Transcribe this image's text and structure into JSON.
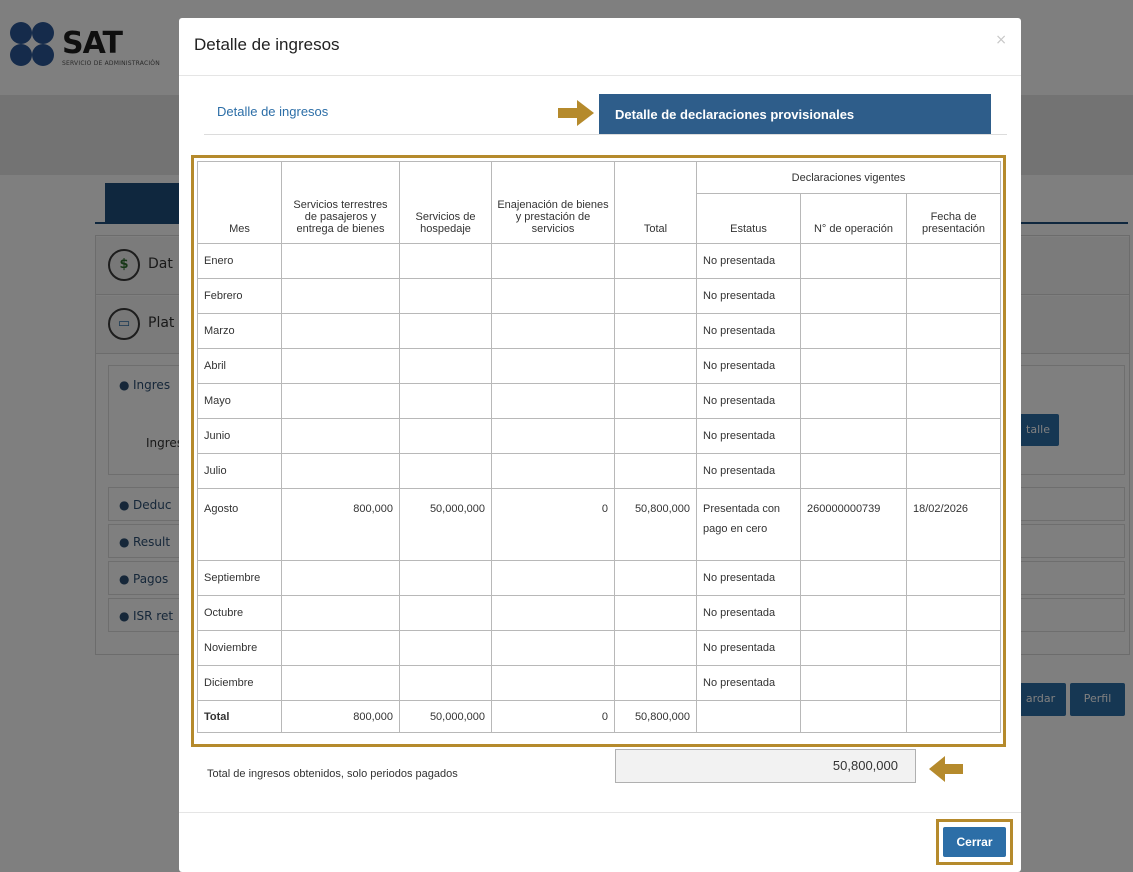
{
  "colors": {
    "accent": "#2c6ea7",
    "tab_active": "#2e5d8a",
    "highlight": "#b58a2c",
    "brand": "#2b5797"
  },
  "background": {
    "logo_text": "SAT",
    "logo_subtitle": "SERVICIO DE ADMINISTRACIÓN",
    "sections": [
      "Dat",
      "Plat"
    ],
    "sub_items": [
      "Ingres",
      "Deduc",
      "Result",
      "Pagos",
      "ISR ret"
    ],
    "ingreso_label": "Ingres",
    "detalle_button": "talle",
    "guardar_button": "ardar",
    "perfil_button": "Perfil"
  },
  "modal": {
    "title": "Detalle de ingresos",
    "close_icon": "×",
    "tabs": [
      {
        "label": "Detalle de ingresos",
        "active": false
      },
      {
        "label": "Detalle de declaraciones provisionales",
        "active": true
      }
    ],
    "table": {
      "headers": {
        "mes": "Mes",
        "terrestres": "Servicios terrestres de pasajeros y entrega de bienes",
        "hospedaje": "Servicios de hospedaje",
        "enajenacion": "Enajenación de bienes y prestación de servicios",
        "total": "Total",
        "group": "Declaraciones vigentes",
        "estatus": "Estatus",
        "operacion": "N° de operación",
        "fecha": "Fecha de presentación"
      },
      "rows": [
        {
          "mes": "Enero",
          "terrestres": "",
          "hospedaje": "",
          "enajenacion": "",
          "total": "",
          "estatus": "No presentada",
          "operacion": "",
          "fecha": ""
        },
        {
          "mes": "Febrero",
          "terrestres": "",
          "hospedaje": "",
          "enajenacion": "",
          "total": "",
          "estatus": "No presentada",
          "operacion": "",
          "fecha": ""
        },
        {
          "mes": "Marzo",
          "terrestres": "",
          "hospedaje": "",
          "enajenacion": "",
          "total": "",
          "estatus": "No presentada",
          "operacion": "",
          "fecha": ""
        },
        {
          "mes": "Abril",
          "terrestres": "",
          "hospedaje": "",
          "enajenacion": "",
          "total": "",
          "estatus": "No presentada",
          "operacion": "",
          "fecha": ""
        },
        {
          "mes": "Mayo",
          "terrestres": "",
          "hospedaje": "",
          "enajenacion": "",
          "total": "",
          "estatus": "No presentada",
          "operacion": "",
          "fecha": ""
        },
        {
          "mes": "Junio",
          "terrestres": "",
          "hospedaje": "",
          "enajenacion": "",
          "total": "",
          "estatus": "No presentada",
          "operacion": "",
          "fecha": ""
        },
        {
          "mes": "Julio",
          "terrestres": "",
          "hospedaje": "",
          "enajenacion": "",
          "total": "",
          "estatus": "No presentada",
          "operacion": "",
          "fecha": ""
        },
        {
          "mes": "Agosto",
          "terrestres": "800,000",
          "hospedaje": "50,000,000",
          "enajenacion": "0",
          "total": "50,800,000",
          "estatus": "Presentada con pago en cero",
          "operacion": "260000000739",
          "fecha": "18/02/2026"
        },
        {
          "mes": "Septiembre",
          "terrestres": "",
          "hospedaje": "",
          "enajenacion": "",
          "total": "",
          "estatus": "No presentada",
          "operacion": "",
          "fecha": ""
        },
        {
          "mes": "Octubre",
          "terrestres": "",
          "hospedaje": "",
          "enajenacion": "",
          "total": "",
          "estatus": "No presentada",
          "operacion": "",
          "fecha": ""
        },
        {
          "mes": "Noviembre",
          "terrestres": "",
          "hospedaje": "",
          "enajenacion": "",
          "total": "",
          "estatus": "No presentada",
          "operacion": "",
          "fecha": ""
        },
        {
          "mes": "Diciembre",
          "terrestres": "",
          "hospedaje": "",
          "enajenacion": "",
          "total": "",
          "estatus": "No presentada",
          "operacion": "",
          "fecha": ""
        }
      ],
      "totals": {
        "label": "Total",
        "terrestres": "800,000",
        "hospedaje": "50,000,000",
        "enajenacion": "0",
        "total": "50,800,000"
      }
    },
    "summary": {
      "label": "Total de ingresos obtenidos, solo periodos pagados",
      "value": "50,800,000"
    },
    "close_button": "Cerrar"
  }
}
